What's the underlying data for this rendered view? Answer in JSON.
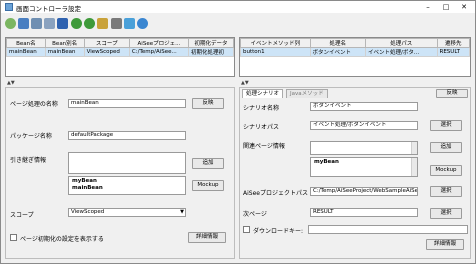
{
  "window": {
    "title": "画面コントローラ設定",
    "controls": {
      "minimize": "–",
      "maximize": "□",
      "close": "✕"
    }
  },
  "toolbar": {
    "icons": [
      "gear-icon",
      "save-icon",
      "list-icon",
      "list-edit-icon",
      "wand-icon",
      "undo-icon",
      "redo-icon",
      "refresh-icon",
      "import-icon",
      "export-icon",
      "info-icon"
    ]
  },
  "bean_table": {
    "columns": [
      "Bean名",
      "Bean別名",
      "スコープ",
      "AiSeeプロジェ...",
      "初期化データ"
    ],
    "rows": [
      [
        "mainBean",
        "mainBean",
        "ViewScoped",
        "C:/Temp/AiSee...",
        "初期化処理初"
      ]
    ]
  },
  "event_table": {
    "columns": [
      "イベントメソッド列",
      "処理名",
      "処理パス",
      "遷移先"
    ],
    "rows": [
      [
        "button1",
        "ボタンイベント",
        "イベント処理/ボタ...",
        "RESULT"
      ]
    ]
  },
  "left": {
    "page_process_name_label": "ページ処理の名称",
    "page_process_name_value": "mainBean",
    "reflect_button": "反映",
    "package_name_label": "パッケージ名称",
    "package_name_value": "defaultPackage",
    "inherit_info_label": "引き継ぎ情報",
    "add_button": "追加",
    "mockup_button": "Mockup",
    "inherit_list": [
      "myBean",
      "mainBean"
    ],
    "scope_label": "スコープ",
    "scope_value": "ViewScoped",
    "page_init_checkbox": "ページ初期化の設定を表示する",
    "detail_button": "詳細情報"
  },
  "right": {
    "tabs": [
      "処理シナリオ",
      "Javaメソッド"
    ],
    "reflect_button": "反映",
    "scenario_name_label": "シナリオ名称",
    "scenario_name_value": "ボタンイベント",
    "scenario_path_label": "シナリオパス",
    "scenario_path_value": "イベント処理/ボタンイベント",
    "select_button": "選択",
    "related_page_label": "関連ページ情報",
    "add_button": "追加",
    "mockup_button": "Mockup",
    "related_list": [
      "myBean"
    ],
    "aisee_path_label": "AiSeeプロジェクトパス",
    "aisee_path_value": "C:/Temp/AiSeeProject/WebSampleAiSee",
    "next_page_label": "次ページ",
    "next_page_value": "RESULT",
    "download_checkbox": "ダウンロードキー:",
    "detail_button": "詳細情報"
  }
}
